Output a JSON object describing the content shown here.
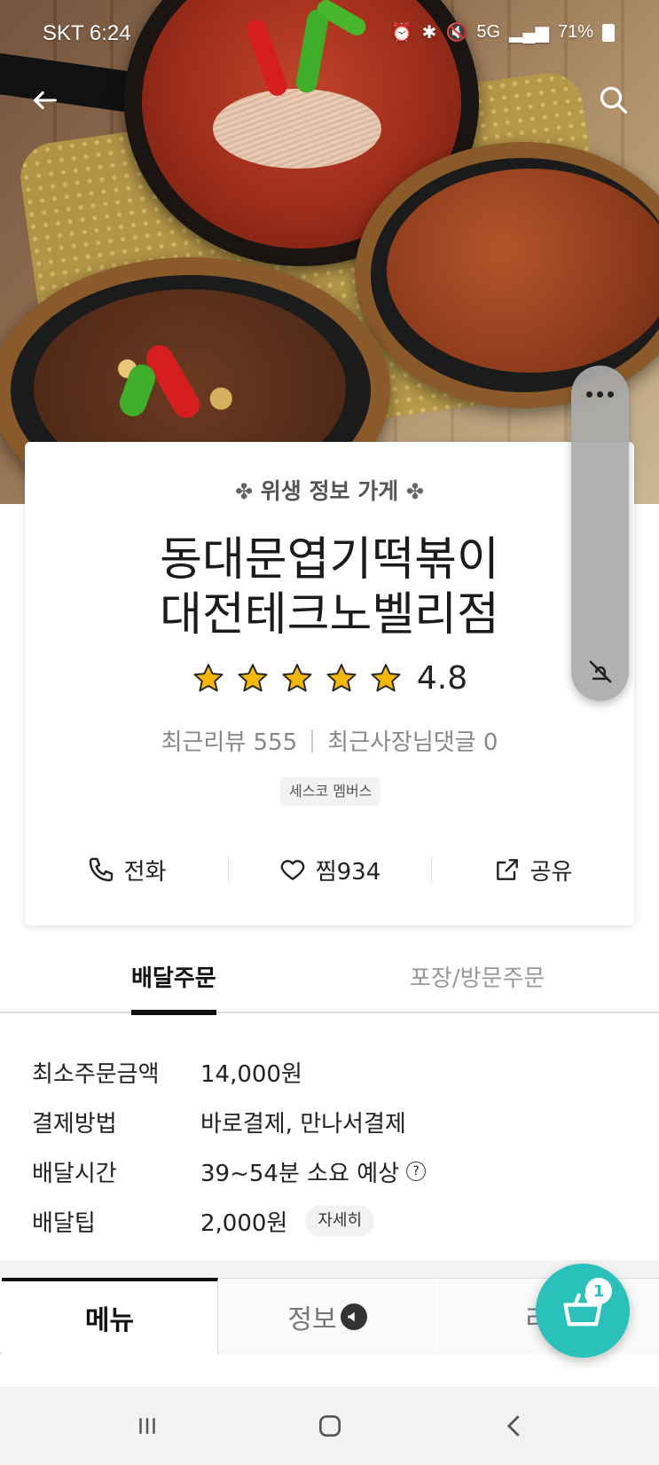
{
  "status_bar": {
    "carrier_time": "SKT 6:24",
    "battery": "71%",
    "network": "5G"
  },
  "store": {
    "hygiene_label": "위생 정보 가게",
    "name_line1": "동대문엽기떡볶이",
    "name_line2": "대전테크노벨리점",
    "rating": "4.8",
    "stars": 5,
    "reviews_label": "최근리뷰 555",
    "owner_replies_label": "최근사장님댓글 0",
    "badge": "세스코 멤버스"
  },
  "actions": {
    "call": "전화",
    "like": "찜934",
    "share": "공유"
  },
  "order_tabs": {
    "delivery": "배달주문",
    "pickup": "포장/방문주문"
  },
  "info": [
    {
      "label": "최소주문금액",
      "value": "14,000원"
    },
    {
      "label": "결제방법",
      "value": "바로결제, 만나서결제"
    },
    {
      "label": "배달시간",
      "value": "39~54분 소요 예상"
    },
    {
      "label": "배달팁",
      "value": "2,000원",
      "chip": "자세히"
    }
  ],
  "menu_tabs": {
    "menu": "메뉴",
    "info": "정보",
    "review": "리"
  },
  "cart": {
    "count": "1"
  },
  "colors": {
    "accent": "#2bc1bb",
    "star": "#f5b800"
  }
}
